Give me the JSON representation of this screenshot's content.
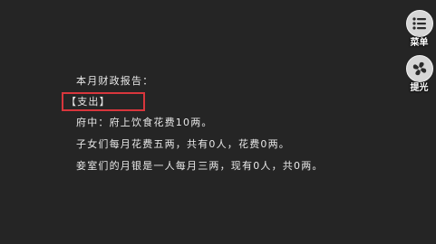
{
  "report": {
    "title": "本月财政报告：",
    "section": "【支出】",
    "lines": [
      "府中：府上饮食花费10两。",
      "子女们每月花费五两，共有0人，花费0两。",
      "妾室们的月银是一人每月三两，现有0人，共0两。"
    ]
  },
  "side_buttons": {
    "menu_label": "菜单",
    "hint_label": "提光"
  },
  "colors": {
    "background": "#252525",
    "highlight_border": "#d8363c",
    "text": "#e8e8e8",
    "button_face": "#d6d6d6"
  }
}
